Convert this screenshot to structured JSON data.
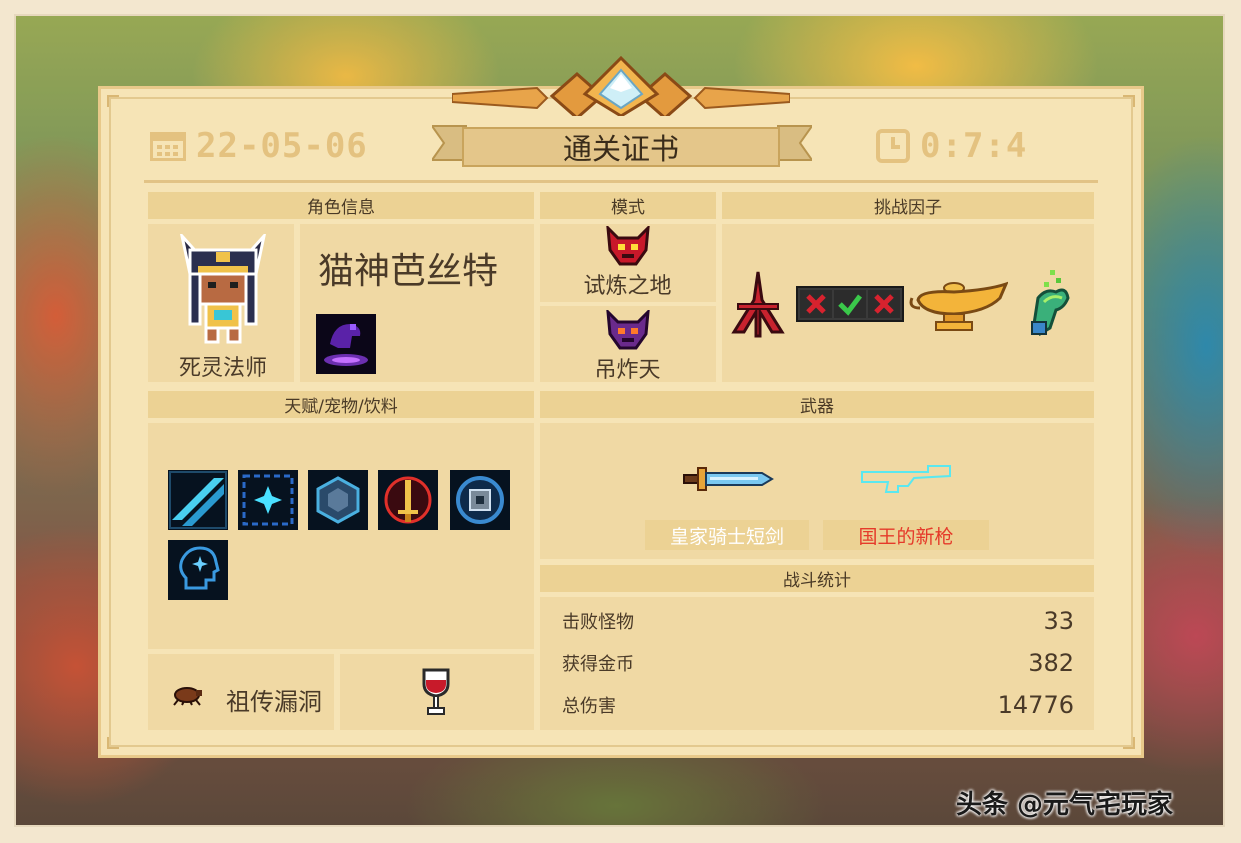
{
  "header": {
    "date": "22-05-06",
    "title": "通关证书",
    "time": "0:7:4"
  },
  "sections": {
    "character_info": "角色信息",
    "mode": "模式",
    "challenge_factors": "挑战因子",
    "talents_pets_drinks": "天赋/宠物/饮料",
    "weapons": "武器",
    "battle_stats": "战斗统计"
  },
  "character": {
    "name": "猫神芭丝特",
    "class": "死灵法师",
    "portrait_icon": "cat-goddess-portrait-icon",
    "skill_icon": "purple-hand-skill-icon"
  },
  "modes": [
    {
      "label": "试炼之地",
      "icon": "red-demon-mask-icon"
    },
    {
      "label": "吊炸天",
      "icon": "purple-demon-mask-icon"
    }
  ],
  "challenge_factors": [
    {
      "icon": "red-tripod-rune-icon"
    },
    {
      "icon": "cross-check-cross-icon"
    },
    {
      "icon": "golden-magic-lamp-icon"
    },
    {
      "icon": "green-flame-hand-icon"
    }
  ],
  "talents": [
    {
      "icon": "cyan-slash-icon"
    },
    {
      "icon": "blue-sparkle-icon"
    },
    {
      "icon": "hexagon-shield-icon"
    },
    {
      "icon": "red-sword-circle-icon"
    },
    {
      "icon": "blue-chip-icon"
    },
    {
      "icon": "brain-head-icon"
    }
  ],
  "pet": {
    "label": "祖传漏洞",
    "icon": "bug-pet-icon"
  },
  "drink": {
    "icon": "red-wine-glass-icon"
  },
  "weapons": [
    {
      "name": "皇家骑士短剑",
      "icon": "royal-knight-dagger-icon",
      "label_color": "#ffffff"
    },
    {
      "name": "国王的新枪",
      "icon": "kings-new-gun-icon",
      "label_color": "#e53a2a"
    }
  ],
  "stats": [
    {
      "label": "击败怪物",
      "value": "33"
    },
    {
      "label": "获得金币",
      "value": "382"
    },
    {
      "label": "总伤害",
      "value": "14776"
    }
  ],
  "watermark": "头条 @元气宅玩家",
  "colors": {
    "card_bg": "#f6e4b6",
    "section_head": "#ecd294",
    "gold_text": "#e4c280",
    "text": "#4a3a28"
  }
}
